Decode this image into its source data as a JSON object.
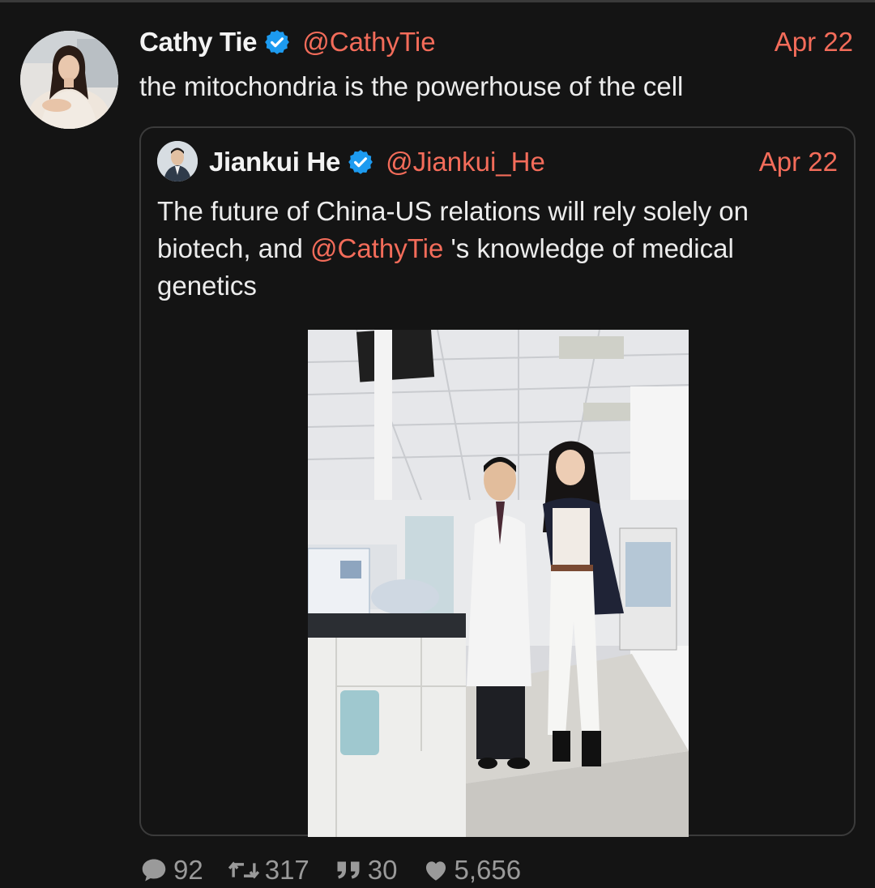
{
  "tweet": {
    "author_name": "Cathy Tie",
    "handle": "@CathyTie",
    "date": "Apr 22",
    "text": "the mitochondria is the powerhouse of the cell"
  },
  "quoted": {
    "author_name": "Jiankui He",
    "handle": "@Jiankui_He",
    "date": "Apr 22",
    "text_before": "The future of China-US relations will rely solely on biotech, and ",
    "mention": "@CathyTie",
    "text_after": " 's knowledge of medical genetics"
  },
  "stats": {
    "replies": "92",
    "retweets": "317",
    "quotes": "30",
    "likes": "5,656"
  },
  "colors": {
    "accent": "#f36c5a",
    "verified": "#1d9bf0",
    "background": "#141414"
  }
}
